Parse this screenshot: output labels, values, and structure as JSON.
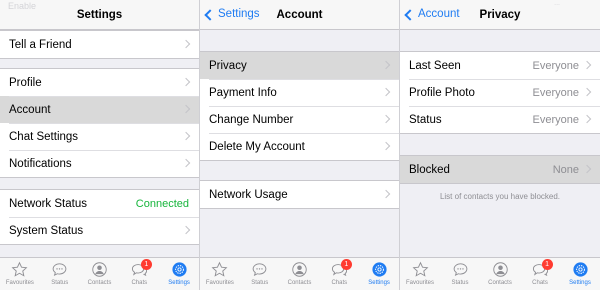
{
  "colors": {
    "accent": "#1f7cf2",
    "connected": "#17b53c",
    "badge": "#ff3b30",
    "selected_row": "#d9d9d9"
  },
  "panel1": {
    "ghost_text": "Enable",
    "nav_title": "Settings",
    "group1": [
      {
        "label": "Tell a Friend"
      }
    ],
    "group2": [
      {
        "label": "Profile"
      },
      {
        "label": "Account",
        "selected": true
      },
      {
        "label": "Chat Settings"
      },
      {
        "label": "Notifications"
      }
    ],
    "group3": [
      {
        "label": "Network Status",
        "value": "Connected"
      },
      {
        "label": "System Status"
      }
    ]
  },
  "panel2": {
    "back_label": "Settings",
    "nav_title": "Account",
    "group1": [
      {
        "label": "Privacy",
        "selected": true
      },
      {
        "label": "Payment Info"
      },
      {
        "label": "Change Number"
      },
      {
        "label": "Delete My Account"
      }
    ],
    "group2": [
      {
        "label": "Network Usage"
      }
    ]
  },
  "panel3": {
    "ghost_text": "...",
    "back_label": "Account",
    "nav_title": "Privacy",
    "group1": [
      {
        "label": "Last Seen",
        "value": "Everyone"
      },
      {
        "label": "Profile Photo",
        "value": "Everyone"
      },
      {
        "label": "Status",
        "value": "Everyone"
      }
    ],
    "group2": [
      {
        "label": "Blocked",
        "value": "None",
        "selected": true
      }
    ],
    "blocked_note": "List of contacts you have blocked."
  },
  "tabbar": {
    "items": [
      {
        "label": "Favourites",
        "icon": "star-icon"
      },
      {
        "label": "Status",
        "icon": "speech-bubble-icon"
      },
      {
        "label": "Contacts",
        "icon": "person-icon"
      },
      {
        "label": "Chats",
        "icon": "chat-bubbles-icon",
        "badge": "1"
      },
      {
        "label": "Settings",
        "icon": "gear-icon",
        "active": true
      }
    ]
  }
}
